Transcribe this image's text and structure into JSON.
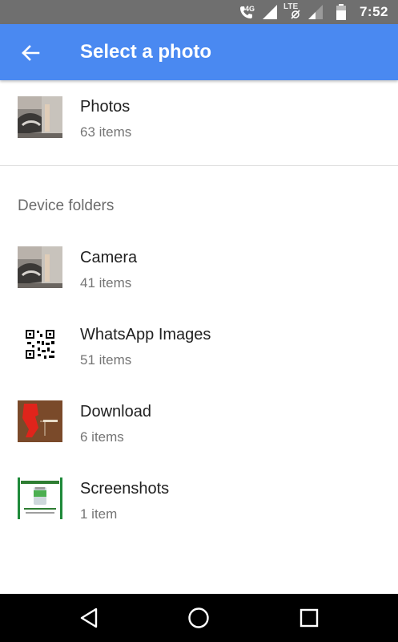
{
  "status_bar": {
    "time": "7:52",
    "network_label": "4G",
    "lte_label": "LTE",
    "icons": [
      "call-icon",
      "signal-icon",
      "data-off-icon",
      "battery-icon"
    ]
  },
  "app_bar": {
    "title": "Select a photo",
    "back_icon": "arrow-left-icon",
    "color": "#4a89f1"
  },
  "photos": {
    "name": "Photos",
    "count": "63 items"
  },
  "device_folders": {
    "header": "Device folders",
    "items": [
      {
        "name": "Camera",
        "count": "41 items"
      },
      {
        "name": "WhatsApp Images",
        "count": "51 items"
      },
      {
        "name": "Download",
        "count": "6 items"
      },
      {
        "name": "Screenshots",
        "count": "1 item"
      }
    ]
  },
  "nav_bar": {
    "buttons": [
      "back-triangle-icon",
      "home-circle-icon",
      "recents-square-icon"
    ]
  }
}
